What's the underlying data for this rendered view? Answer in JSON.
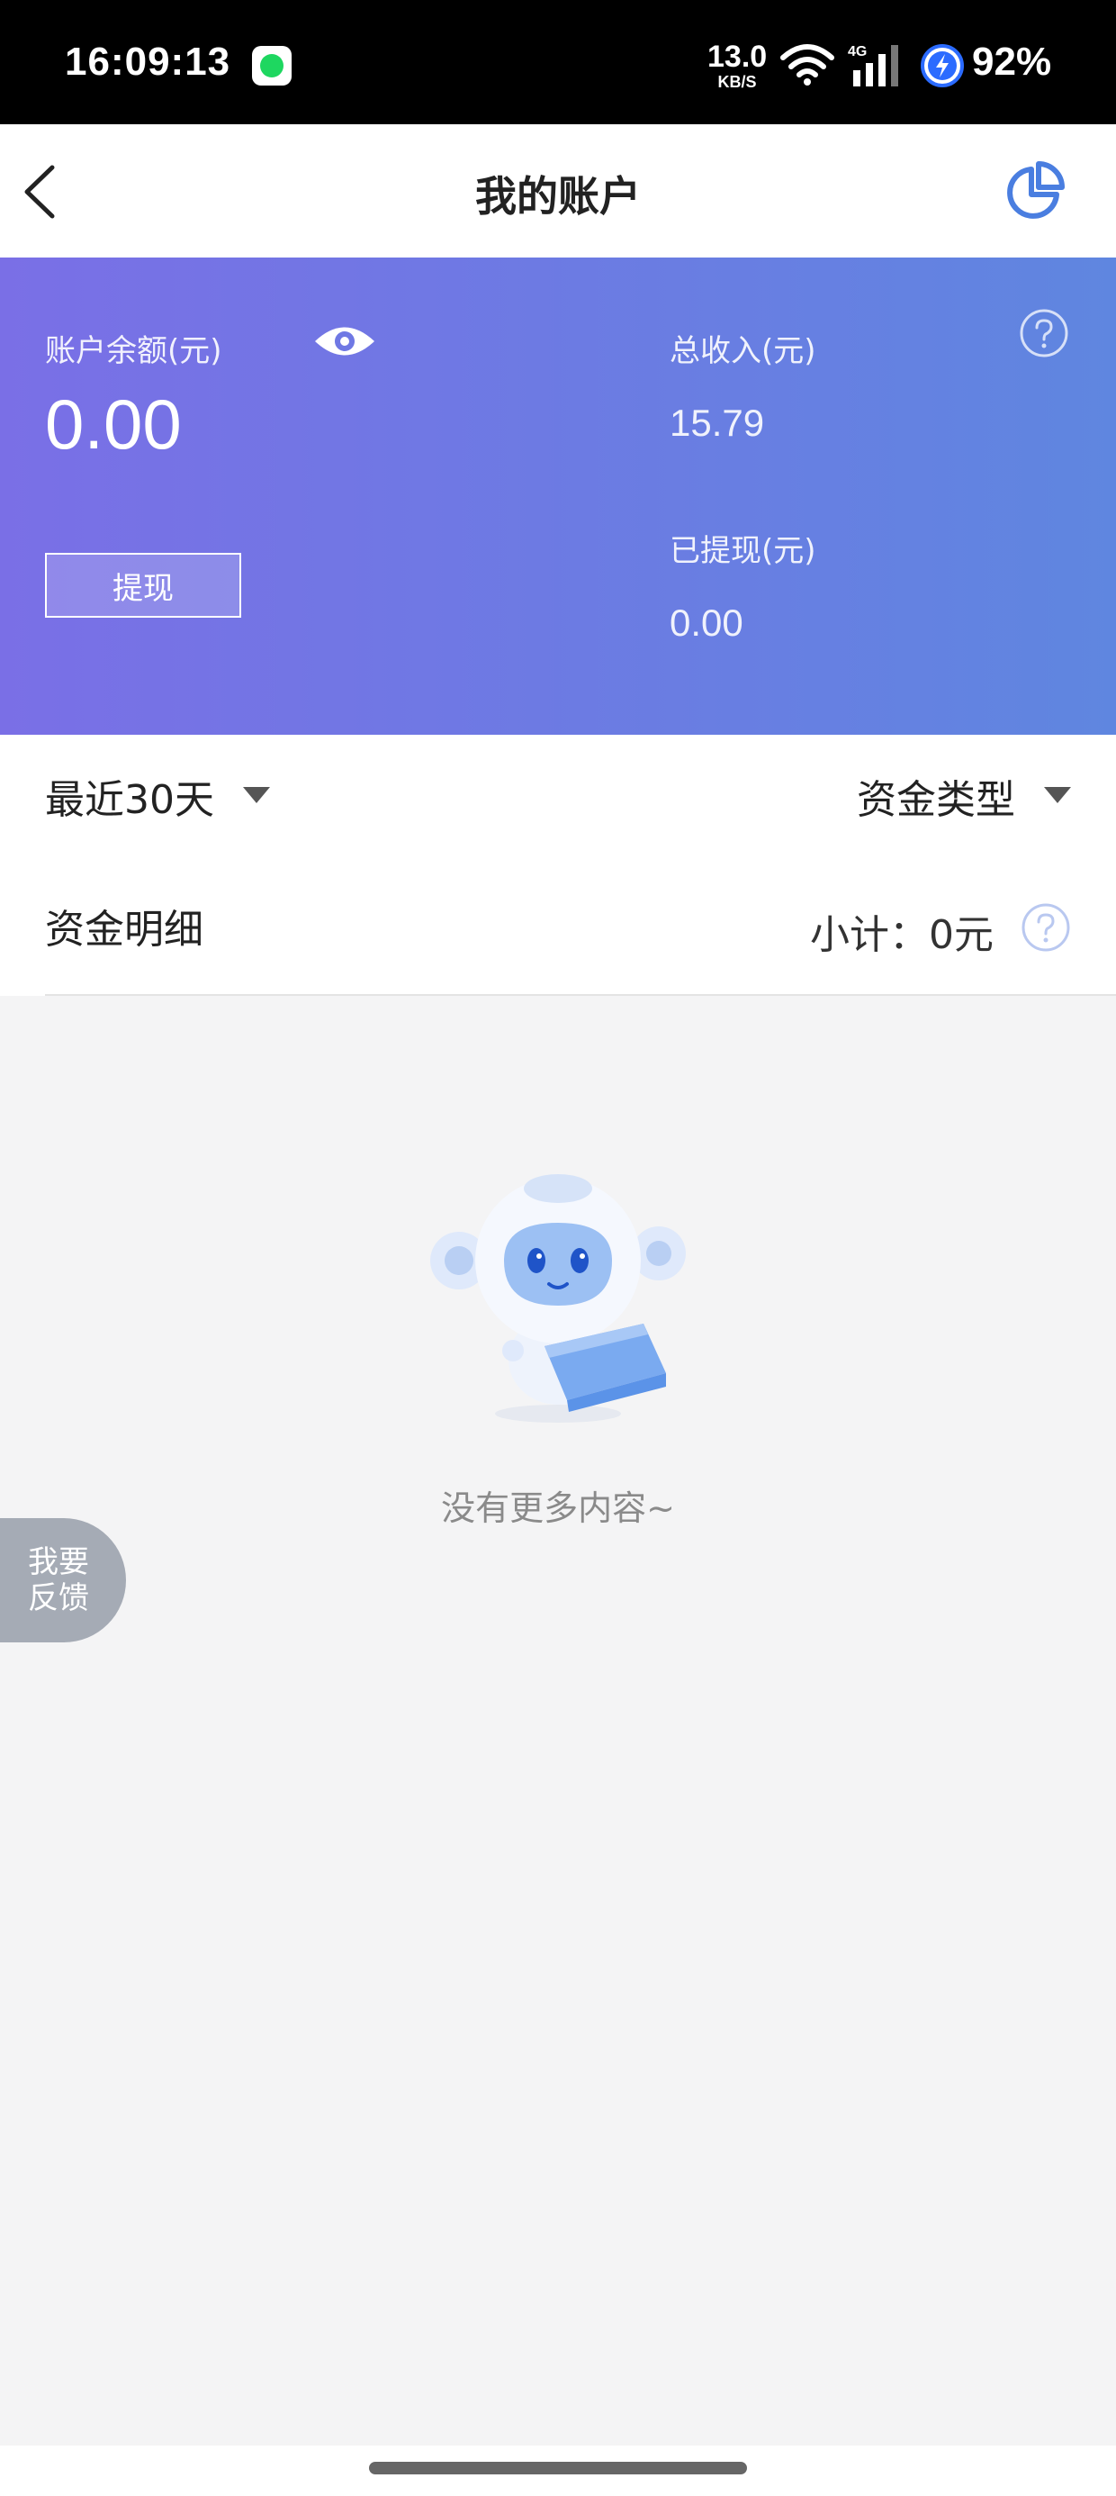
{
  "status_bar": {
    "time": "16:09:13",
    "net_speed": "13.0",
    "net_unit": "KB/S",
    "network": "4G",
    "battery": "92%"
  },
  "nav": {
    "title": "我的账户",
    "back_icon": "chevron-left-icon",
    "stats_icon": "pie-chart-icon"
  },
  "account": {
    "balance_label": "账户余额(元)",
    "balance_value": "0.00",
    "withdraw_button": "提现",
    "income_label": "总收入(元)",
    "income_value": "15.79",
    "withdrawn_label": "已提现(元)",
    "withdrawn_value": "0.00",
    "gradient_start": "#7a6fe6",
    "gradient_end": "#5f86e0"
  },
  "filters": {
    "period": "最近30天",
    "type": "资金类型"
  },
  "detail": {
    "title": "资金明细",
    "subtotal": "小计：0元"
  },
  "empty": {
    "message": "没有更多内容~"
  },
  "feedback": {
    "line1": "我要",
    "line2": "反馈"
  }
}
